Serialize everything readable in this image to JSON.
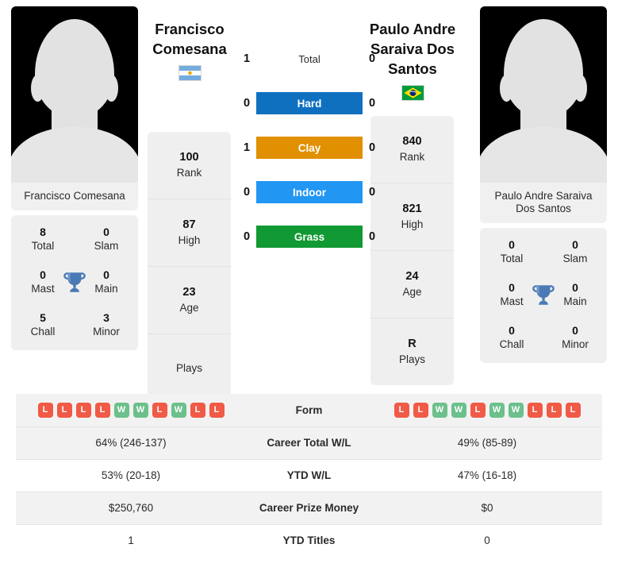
{
  "players": {
    "left": {
      "name": "Francisco Comesana",
      "name_lines": [
        "Francisco",
        "Comesana"
      ],
      "photo_caption": "Francisco Comesana",
      "flag": "argentina-flag",
      "rank": "100",
      "rank_label": "Rank",
      "high": "87",
      "high_label": "High",
      "age": "23",
      "age_label": "Age",
      "plays": "",
      "plays_label": "Plays",
      "titles": {
        "total": "8",
        "total_label": "Total",
        "slam": "0",
        "slam_label": "Slam",
        "mast": "0",
        "mast_label": "Mast",
        "main": "0",
        "main_label": "Main",
        "chall": "5",
        "chall_label": "Chall",
        "minor": "3",
        "minor_label": "Minor"
      },
      "form": [
        "L",
        "L",
        "L",
        "L",
        "W",
        "W",
        "L",
        "W",
        "L",
        "L"
      ],
      "career_wl": "64% (246-137)",
      "ytd_wl": "53% (20-18)",
      "prize_money": "$250,760",
      "ytd_titles": "1"
    },
    "right": {
      "name": "Paulo Andre Saraiva Dos Santos",
      "name_lines": [
        "Paulo Andre",
        "Saraiva Dos",
        "Santos"
      ],
      "photo_caption": "Paulo Andre Saraiva Dos Santos",
      "flag": "brazil-flag",
      "rank": "840",
      "rank_label": "Rank",
      "high": "821",
      "high_label": "High",
      "age": "24",
      "age_label": "Age",
      "plays": "R",
      "plays_label": "Plays",
      "titles": {
        "total": "0",
        "total_label": "Total",
        "slam": "0",
        "slam_label": "Slam",
        "mast": "0",
        "mast_label": "Mast",
        "main": "0",
        "main_label": "Main",
        "chall": "0",
        "chall_label": "Chall",
        "minor": "0",
        "minor_label": "Minor"
      },
      "form": [
        "L",
        "L",
        "W",
        "W",
        "L",
        "W",
        "W",
        "L",
        "L",
        "L"
      ],
      "career_wl": "49% (85-89)",
      "ytd_wl": "47% (16-18)",
      "prize_money": "$0",
      "ytd_titles": "0"
    }
  },
  "head_to_head": [
    {
      "label": "Total",
      "left": "1",
      "right": "0",
      "color": "",
      "style": "plain"
    },
    {
      "label": "Hard",
      "left": "0",
      "right": "0",
      "color": "#1070c0",
      "style": "bar"
    },
    {
      "label": "Clay",
      "left": "1",
      "right": "0",
      "color": "#e09000",
      "style": "bar"
    },
    {
      "label": "Indoor",
      "left": "0",
      "right": "0",
      "color": "#2196f3",
      "style": "bar"
    },
    {
      "label": "Grass",
      "left": "0",
      "right": "0",
      "color": "#119933",
      "style": "bar"
    }
  ],
  "table_rows": [
    {
      "label": "Form",
      "left": "",
      "right": "",
      "type": "form",
      "shaded": true
    },
    {
      "label": "Career Total W/L",
      "left": "64% (246-137)",
      "right": "49% (85-89)",
      "type": "text",
      "shaded": true
    },
    {
      "label": "YTD W/L",
      "left": "53% (20-18)",
      "right": "47% (16-18)",
      "type": "text",
      "shaded": false
    },
    {
      "label": "Career Prize Money",
      "left": "$250,760",
      "right": "$0",
      "type": "text",
      "shaded": true
    },
    {
      "label": "YTD Titles",
      "left": "1",
      "right": "0",
      "type": "text",
      "shaded": false
    }
  ],
  "colors": {
    "win": "#6cc08b",
    "loss": "#f05a46",
    "trophy": "#4a7ab5",
    "card_bg": "#efefef"
  }
}
